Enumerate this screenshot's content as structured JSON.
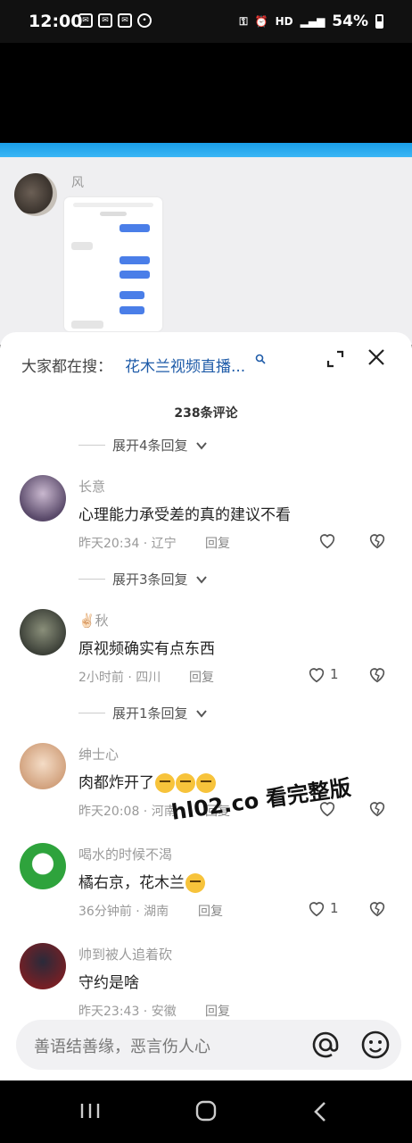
{
  "status_bar": {
    "time": "12:00",
    "hd": "HD",
    "battery": "54%"
  },
  "post": {
    "author": "风"
  },
  "sheet": {
    "search_hint": "大家都在搜：",
    "search_link": "花木兰视频直播...",
    "comment_count": "238条评论",
    "expand_top": "展开4条回复",
    "comments": [
      {
        "name": "长意",
        "text": "心理能力承受差的真的建议不看",
        "meta": "昨天20:34 · 辽宁",
        "reply": "回复",
        "likes": "",
        "avatar_color": "#5a4a6a"
      },
      {
        "name": "✌🏻秋",
        "text": "原视频确实有点东西",
        "meta": "2小时前 · 四川",
        "reply": "回复",
        "likes": "1",
        "avatar_color": "#3c4038"
      },
      {
        "name": "绅士心",
        "text": "肉都炸开了",
        "meta": "昨天20:08 · 河南",
        "reply": "回复",
        "likes": "",
        "avatar_color": "#d2a27e"
      },
      {
        "name": "喝水的时候不渴",
        "text": "橘右京，花木兰",
        "meta": "36分钟前 · 湖南",
        "reply": "回复",
        "likes": "1",
        "avatar_color": "#2ea33c"
      },
      {
        "name": "帅到被人追着砍",
        "text": "守约是啥",
        "meta": "昨天23:43 · 安徽",
        "reply": "回复",
        "likes": "",
        "avatar_color": "#7a1f24"
      }
    ],
    "expand_1": "展开3条回复",
    "expand_2": "展开1条回复",
    "input_placeholder": "善语结善缘，恶言伤人心"
  },
  "watermark": "hl02.co 看完整版",
  "colors": {
    "accent_blue": "#1e5ba8",
    "strip_blue": "#1a9ee8"
  }
}
